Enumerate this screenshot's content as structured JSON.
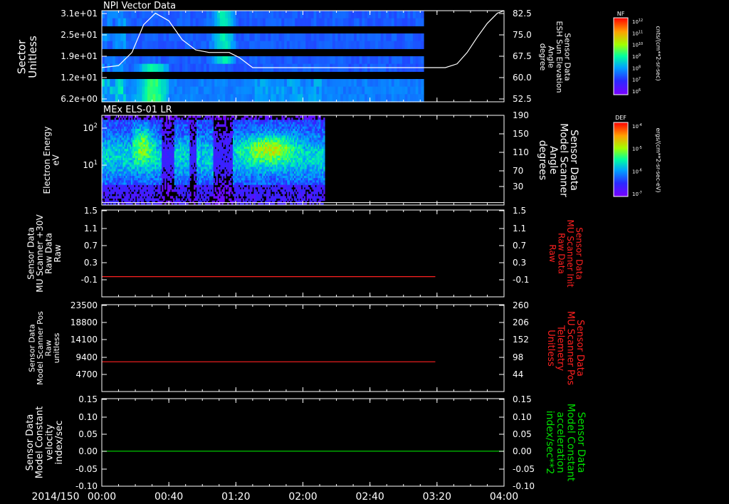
{
  "colors": {
    "white": "#ffffff",
    "red": "#ff2020",
    "green": "#00dd00",
    "bg": "#000000"
  },
  "time_axis": {
    "date": "2014/150",
    "ticks": [
      {
        "t": 0,
        "label": "00:00"
      },
      {
        "t": 40,
        "label": "00:40"
      },
      {
        "t": 80,
        "label": "01:20"
      },
      {
        "t": 120,
        "label": "02:00"
      },
      {
        "t": 160,
        "label": "02:40"
      },
      {
        "t": 200,
        "label": "03:20"
      },
      {
        "t": 240,
        "label": "04:00"
      }
    ]
  },
  "chart_data": [
    {
      "id": "npi",
      "type": "heatmap",
      "title": "NPI Vector Data",
      "ylabel": [
        "Sector",
        "Unitless"
      ],
      "yticks": [
        "3.1e+01",
        "2.5e+01",
        "1.9e+01",
        "1.2e+01",
        "6.2e+00"
      ],
      "y2label": [
        "Sensor Data",
        "ESH Sun Elevation",
        "Angle",
        "degree"
      ],
      "y2ticks": [
        "82.5",
        "75.0",
        "67.5",
        "60.0",
        "52.5"
      ],
      "y2lim": [
        46.5,
        82.5
      ],
      "data_end_minutes": 192,
      "colorbar": {
        "name": "NF",
        "unit": "cnts/(cm**2-sr-sec)",
        "ticks": [
          "10^12",
          "10^11",
          "10^10",
          "10^9",
          "10^8",
          "10^7",
          "10^6"
        ]
      },
      "overlay_line": {
        "x": [
          0,
          10,
          18,
          25,
          32,
          40,
          48,
          56,
          64,
          72,
          76,
          82,
          86,
          90,
          100,
          120,
          150,
          180,
          205,
          212,
          218,
          224,
          230,
          236,
          240
        ],
        "y": [
          60,
          60.8,
          66,
          77,
          81.5,
          78.5,
          71,
          67,
          66,
          66,
          66,
          64,
          62,
          60,
          60,
          60,
          60,
          60,
          60,
          61.5,
          66,
          72,
          77.5,
          81.5,
          82.5
        ]
      }
    },
    {
      "id": "els",
      "type": "heatmap",
      "title": "MEx ELS-01 LR",
      "ylabel": [
        "Electron Energy",
        "eV"
      ],
      "yticks": [
        "10^2",
        "10^1"
      ],
      "y2label": [
        "Sensor Data",
        "Model Scanner",
        "Angle",
        "degrees"
      ],
      "y2ticks": [
        "190",
        "150",
        "110",
        "70",
        "30"
      ],
      "y2lim": [
        0,
        190
      ],
      "data_end_minutes": 133,
      "colorbar": {
        "name": "DEF",
        "unit": "ergs/(cm**2-sr-sec-eV)",
        "ticks": [
          "10^-4",
          "10^-5",
          "10^-6",
          "10^-7"
        ]
      },
      "overlay_value": 5
    },
    {
      "id": "mu_raw",
      "type": "line",
      "ylabel": [
        "Sensor Data",
        "MU Scanner +30V",
        "Raw Data",
        "Raw"
      ],
      "yticks": [
        "1.5",
        "1.1",
        "0.7",
        "0.3",
        "-0.1"
      ],
      "ylim": [
        -0.35,
        1.5
      ],
      "y2label": [
        "Sensor Data",
        "MU Scanner Init",
        "Raw Data",
        "Raw"
      ],
      "y2ticks": [
        "1.5",
        "1.1",
        "0.7",
        "0.3",
        "-0.1"
      ],
      "series": [
        {
          "x": [
            0,
            199
          ],
          "y": [
            0.08,
            0.08
          ]
        }
      ]
    },
    {
      "id": "mu_pos",
      "type": "line",
      "ylabel": [
        "Sensor Data",
        "Model Scanner Pos",
        "Raw",
        "unitless"
      ],
      "yticks": [
        "23500",
        "18800",
        "14100",
        "9400",
        "4700"
      ],
      "ylim": [
        0,
        23500
      ],
      "y2label": [
        "Sensor Data",
        "MU Scanner Pos",
        "Telemetry",
        "Unitless"
      ],
      "y2ticks": [
        "260",
        "206",
        "152",
        "98",
        "44"
      ],
      "series": [
        {
          "x": [
            0,
            199
          ],
          "y": [
            8050,
            8050
          ]
        }
      ]
    },
    {
      "id": "velocity",
      "type": "line",
      "ylabel": [
        "Sensor Data",
        "Model Constant",
        "velocity",
        "index/sec"
      ],
      "yticks": [
        "0.15",
        "0.10",
        "0.05",
        "0.00",
        "-0.05",
        "-0.10"
      ],
      "ylim": [
        -0.1,
        0.15
      ],
      "y2label": [
        "Sensor Data",
        "Model Constant",
        "acceleration",
        "index/sec**2"
      ],
      "y2ticks": [
        "0.15",
        "0.10",
        "0.05",
        "0.00",
        "-0.05",
        "-0.10"
      ],
      "series": [
        {
          "x": [
            0,
            240
          ],
          "y": [
            0,
            0
          ]
        }
      ]
    }
  ]
}
